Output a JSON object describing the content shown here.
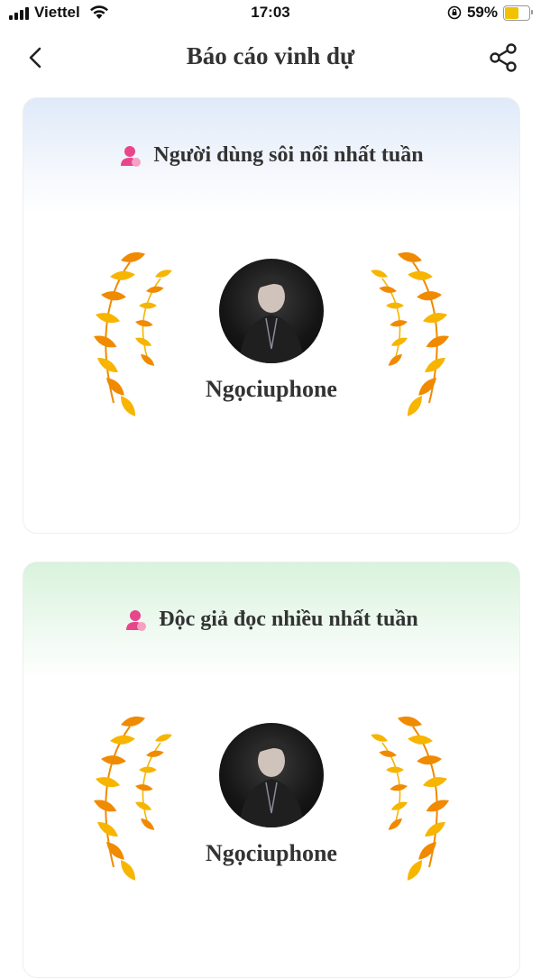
{
  "status_bar": {
    "carrier": "Viettel",
    "time": "17:03",
    "battery_percent": "59%",
    "battery_level": 0.59,
    "icons": [
      "signal-icon",
      "wifi-icon",
      "orientation-lock-icon",
      "battery-icon"
    ]
  },
  "header": {
    "title": "Báo cáo vinh dự",
    "back_icon": "chevron-left-icon",
    "share_icon": "share-icon"
  },
  "cards": [
    {
      "title": "Người dùng sôi nổi nhất tuần",
      "icon": "person-icon",
      "username": "Ngọciuphone",
      "header_color": "#dfeaf9"
    },
    {
      "title": "Độc giả đọc nhiều nhất tuần",
      "icon": "person-icon",
      "username": "Ngọciuphone",
      "header_color": "#d9f3dc"
    }
  ],
  "colors": {
    "accent_pink": "#e8458c",
    "laurel_gold": "#f7b500",
    "laurel_orange": "#f08a00"
  }
}
